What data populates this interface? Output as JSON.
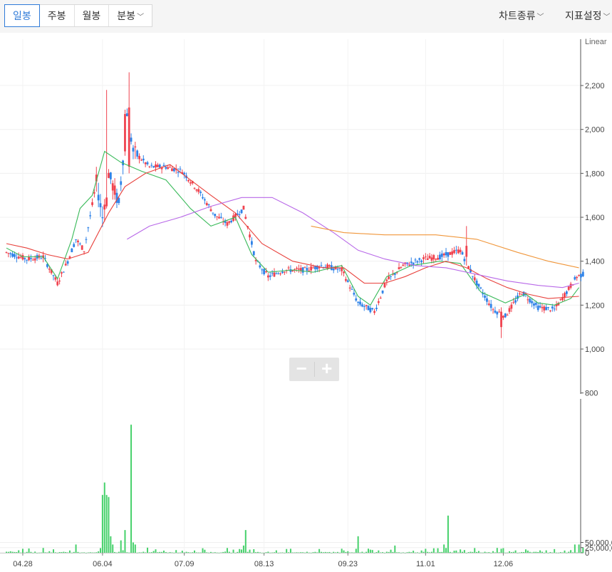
{
  "toolbar": {
    "period_tabs": [
      "일봉",
      "주봉",
      "월봉",
      "분봉"
    ],
    "active_tab": "일봉",
    "chart_type_label": "차트종류",
    "indicator_label": "지표설정",
    "caret": "﹀"
  },
  "zoom": {
    "minus": "−",
    "plus": "+"
  },
  "colors": {
    "up": "#f0434f",
    "down": "#2e82e8",
    "volume": "#46d16b",
    "ma5": "#3aba5a",
    "ma20": "#e8413c",
    "ma60": "#b868e8",
    "ma120": "#f0963a",
    "active": "#2f7bd8"
  },
  "chart_data": {
    "type": "candlestick",
    "scale_label": "Linear",
    "price_axis": {
      "ticks": [
        "2,200",
        "2,000",
        "1,800",
        "1,600",
        "1,400",
        "1,200",
        "1,000",
        "800"
      ],
      "range": [
        800,
        2350
      ]
    },
    "volume_axis": {
      "ticks": [
        "50,000,0",
        "25,000,0",
        "0"
      ],
      "range": [
        0,
        75000000
      ]
    },
    "x_ticks": [
      "04.28",
      "06.04",
      "07.09",
      "08.13",
      "09.23",
      "11.01",
      "12.06"
    ],
    "ma_lines": [
      {
        "name": "ma5",
        "color": "#3aba5a",
        "values": [
          [
            0,
            1460
          ],
          [
            8,
            1420
          ],
          [
            18,
            1420
          ],
          [
            25,
            1320
          ],
          [
            32,
            1500
          ],
          [
            36,
            1640
          ],
          [
            42,
            1700
          ],
          [
            48,
            1900
          ],
          [
            56,
            1850
          ],
          [
            66,
            1810
          ],
          [
            78,
            1770
          ],
          [
            90,
            1640
          ],
          [
            100,
            1560
          ],
          [
            112,
            1600
          ],
          [
            120,
            1430
          ],
          [
            128,
            1350
          ],
          [
            140,
            1360
          ],
          [
            150,
            1350
          ],
          [
            164,
            1380
          ],
          [
            172,
            1240
          ],
          [
            178,
            1200
          ],
          [
            186,
            1330
          ],
          [
            198,
            1380
          ],
          [
            212,
            1400
          ],
          [
            222,
            1390
          ],
          [
            232,
            1260
          ],
          [
            244,
            1210
          ],
          [
            254,
            1250
          ],
          [
            260,
            1210
          ],
          [
            268,
            1200
          ],
          [
            276,
            1230
          ],
          [
            280,
            1280
          ]
        ]
      },
      {
        "name": "ma20",
        "color": "#e8413c",
        "values": [
          [
            0,
            1480
          ],
          [
            10,
            1460
          ],
          [
            20,
            1430
          ],
          [
            30,
            1410
          ],
          [
            40,
            1440
          ],
          [
            50,
            1620
          ],
          [
            58,
            1740
          ],
          [
            68,
            1800
          ],
          [
            80,
            1840
          ],
          [
            90,
            1770
          ],
          [
            100,
            1700
          ],
          [
            112,
            1620
          ],
          [
            125,
            1480
          ],
          [
            140,
            1400
          ],
          [
            155,
            1370
          ],
          [
            165,
            1370
          ],
          [
            175,
            1300
          ],
          [
            185,
            1300
          ],
          [
            195,
            1330
          ],
          [
            205,
            1370
          ],
          [
            215,
            1400
          ],
          [
            225,
            1370
          ],
          [
            235,
            1320
          ],
          [
            245,
            1280
          ],
          [
            255,
            1250
          ],
          [
            265,
            1230
          ],
          [
            280,
            1240
          ]
        ]
      },
      {
        "name": "ma60",
        "color": "#b868e8",
        "values": [
          [
            59,
            1500
          ],
          [
            70,
            1560
          ],
          [
            85,
            1600
          ],
          [
            100,
            1650
          ],
          [
            115,
            1690
          ],
          [
            130,
            1690
          ],
          [
            145,
            1620
          ],
          [
            160,
            1530
          ],
          [
            172,
            1450
          ],
          [
            185,
            1410
          ],
          [
            200,
            1380
          ],
          [
            215,
            1370
          ],
          [
            230,
            1340
          ],
          [
            245,
            1310
          ],
          [
            260,
            1290
          ],
          [
            272,
            1280
          ],
          [
            280,
            1300
          ]
        ]
      },
      {
        "name": "ma120",
        "color": "#f0963a",
        "values": [
          [
            149,
            1560
          ],
          [
            165,
            1530
          ],
          [
            185,
            1520
          ],
          [
            210,
            1520
          ],
          [
            230,
            1500
          ],
          [
            250,
            1440
          ],
          [
            265,
            1400
          ],
          [
            280,
            1370
          ]
        ]
      }
    ]
  }
}
